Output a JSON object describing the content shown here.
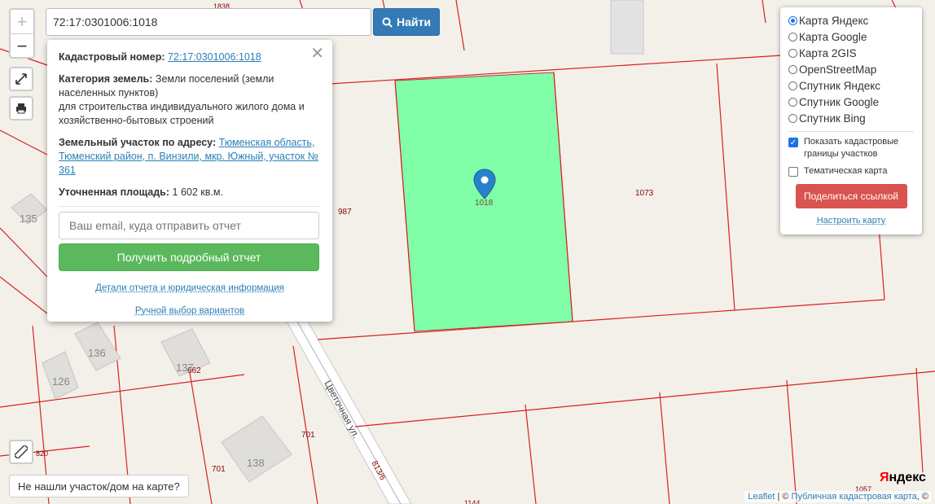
{
  "search": {
    "value": "72:17:0301006:1018",
    "button_label": "Найти"
  },
  "zoom": {
    "in_label": "+",
    "out_label": "−"
  },
  "popup": {
    "cadastral_label": "Кадастровый номер:",
    "cadastral_value": "72:17:0301006:1018",
    "category_label": "Категория земель:",
    "category_value": "Земли поселений (земли населенных пунктов)",
    "category_use": "для строительства индивидуального жилого дома и хозяйственно-бытовых строений",
    "address_label": "Земельный участок по адресу:",
    "address_value": "Тюменская область, Тюменский район, п. Винзили, мкр. Южный, участок № 361",
    "area_label": "Уточненная площадь:",
    "area_value": "1 602 кв.м.",
    "email_placeholder": "Ваш email, куда отправить отчет",
    "report_button": "Получить подробный отчет",
    "details_link": "Детали отчета и юридическая информация",
    "manual_link": "Ручной выбор вариантов"
  },
  "layers": {
    "options": [
      {
        "label": "Карта Яндекс",
        "selected": true
      },
      {
        "label": "Карта Google",
        "selected": false
      },
      {
        "label": "Карта 2GIS",
        "selected": false
      },
      {
        "label": "OpenStreetMap",
        "selected": false
      },
      {
        "label": "Спутник Яндекс",
        "selected": false
      },
      {
        "label": "Спутник Google",
        "selected": false
      },
      {
        "label": "Спутник Bing",
        "selected": false
      }
    ],
    "show_borders_label": "Показать кадастровые границы участков",
    "show_borders_checked": true,
    "thematic_label": "Тематическая карта",
    "thematic_checked": false,
    "share_button": "Поделиться ссылкой",
    "configure_link": "Настроить карту"
  },
  "map": {
    "parcel_labels": [
      "1018",
      "1073",
      "987",
      "662",
      "701",
      "701",
      "813/6",
      "1838",
      "1057",
      "1144",
      "820"
    ],
    "building_labels": [
      "135",
      "136",
      "126",
      "137",
      "138"
    ],
    "street_label": "Цветочная ул.",
    "highlight_color": "#80ffa8",
    "boundary_color": "#d92020"
  },
  "not_found_button": "Не нашли участок/дом на карте?",
  "attribution": {
    "leaflet": "Leaflet",
    "sep": " | © ",
    "source": "Публичная кадастровая карта",
    "tail": ", ©"
  },
  "yandex_logo": {
    "first": "Я",
    "rest": "ндекс"
  }
}
